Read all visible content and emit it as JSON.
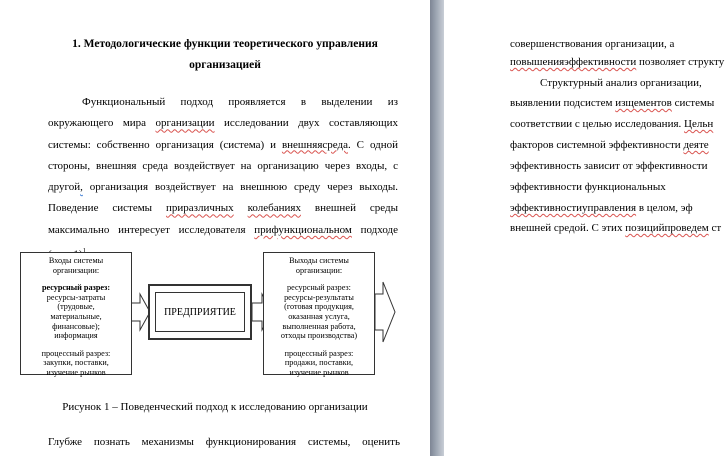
{
  "left": {
    "heading_line1": "1. Методологические функции теоретического управления",
    "heading_line2": "организацией",
    "p1": {
      "a": "Функциональный подход проявляется в выделении из окружающего мира ",
      "w1": "организации",
      "b": " исследовании двух составляющих системы: собственно организация (система) и ",
      "w2": "внешняясреда",
      "c": ". С одной стороны, внешняя среда воздействует на организацию через входы, с другой",
      "d": " организация воздействует на внешнюю среду через выходы. Поведение системы ",
      "w3": "приразличных",
      "e": " ",
      "w4": "колебаниях",
      "f": " внешней среды максимально интересует исследователя ",
      "w5": "прифункциональном",
      "g": " подходе (рис. 1)",
      "sup": "1",
      "h": "."
    },
    "diagram": {
      "inputs": {
        "title": [
          "Входы системы",
          "организации:"
        ],
        "resource_label": "ресурсный разрез:",
        "resource_lines": [
          "ресурсы-затраты",
          "(трудовые,",
          "материальные,",
          "финансовые);",
          "информация"
        ],
        "process_lines": [
          "процессный разрез:",
          "закупки, поставки,",
          "изучение рынков"
        ]
      },
      "center": "ПРЕДПРИЯТИЕ",
      "outputs": {
        "title": [
          "Выходы системы",
          "организации:"
        ],
        "resource_lines": [
          "ресурсный разрез:",
          "ресурсы-результаты",
          "(готовая продукция,",
          "оказанная услуга,",
          "выполненная работа,",
          "отходы производства)"
        ],
        "process_lines": [
          "процессный разрез:",
          "продажи, поставки,",
          "изучение рынков"
        ]
      }
    },
    "caption": "Рисунок 1 – Поведенческий подход к исследованию организации",
    "p2": "Глубже познать механизмы функционирования системы, оценить"
  },
  "right": {
    "l1": "совершенствования        организации,        а",
    "l2a": "повышенияэффективности",
    "l2b": " позволяет структу",
    "l3": "Структурный анализ организации,",
    "l4a": "выявлении подсистем ",
    "l4w": "изщементов",
    "l4b": " системы",
    "l5a": "соответствии с целью исследования. ",
    "l5w": "Цельн",
    "l6a": "факторов системной эффективности ",
    "l6w": "деяте",
    "l7": "эффективность зависит от эффективности",
    "l8": "эффективности        функциональных",
    "l9a": "эффективностиуправления",
    "l9b": " в целом, эф",
    "l10a": "внешней средой. С этих ",
    "l10w": "позицийпроведем",
    "l10b": " ст"
  }
}
